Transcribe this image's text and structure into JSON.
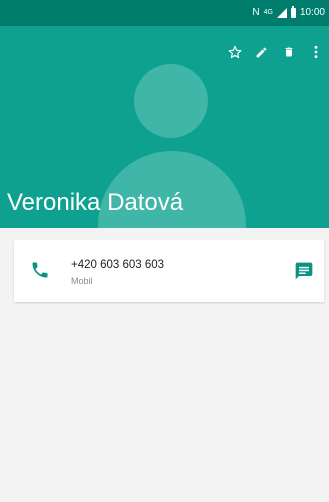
{
  "status_bar": {
    "network_letter": "N",
    "network_type": "4G",
    "time": "10:00"
  },
  "toolbar": {
    "icons": [
      "star-outline-icon",
      "edit-pencil-icon",
      "delete-trash-icon",
      "overflow-menu-icon"
    ]
  },
  "contact": {
    "name": "Veronika Datová",
    "phone_number": "+420 603 603 603",
    "phone_type": "Mobil"
  },
  "colors": {
    "status_bar": "#007c6c",
    "header": "#0fa18f",
    "avatar": "#3fb6a7",
    "accent": "#0b9484",
    "background": "#f3f3f3"
  }
}
